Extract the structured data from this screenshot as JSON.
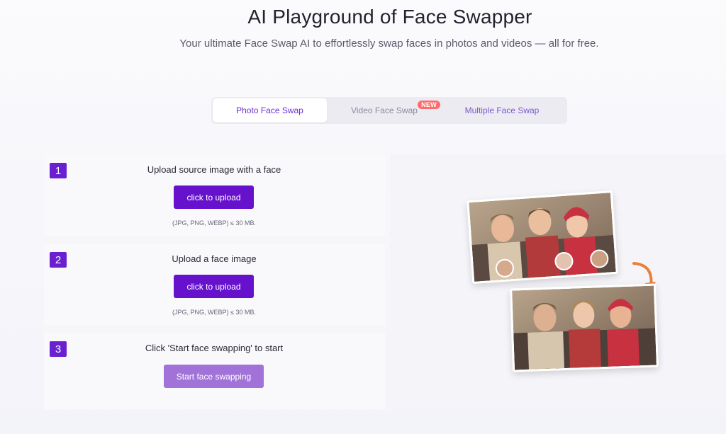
{
  "hero": {
    "title": "AI Playground of Face Swapper",
    "subtitle": "Your ultimate Face Swap AI to effortlessly swap faces in photos and videos — all for free."
  },
  "tabs": [
    {
      "label": "Photo Face Swap",
      "active": true
    },
    {
      "label": "Video Face Swap",
      "badge": "NEW"
    },
    {
      "label": "Multiple Face Swap"
    }
  ],
  "steps": [
    {
      "number": "1",
      "label": "Upload source image with a face",
      "button": "click to upload",
      "hint": "(JPG, PNG, WEBP) ≤ 30 MB."
    },
    {
      "number": "2",
      "label": "Upload a face image",
      "button": "click to upload",
      "hint": "(JPG, PNG, WEBP) ≤ 30 MB."
    },
    {
      "number": "3",
      "label": "Click 'Start face swapping' to start",
      "button": "Start face swapping"
    }
  ],
  "colors": {
    "accent": "#6612cc",
    "accent_light": "#a173d8",
    "badge": "#ff6b6b",
    "arrow": "#e8823a"
  },
  "illustration": {
    "icons": [
      "group-photo-original",
      "arrow-down-icon",
      "group-photo-swapped"
    ]
  }
}
